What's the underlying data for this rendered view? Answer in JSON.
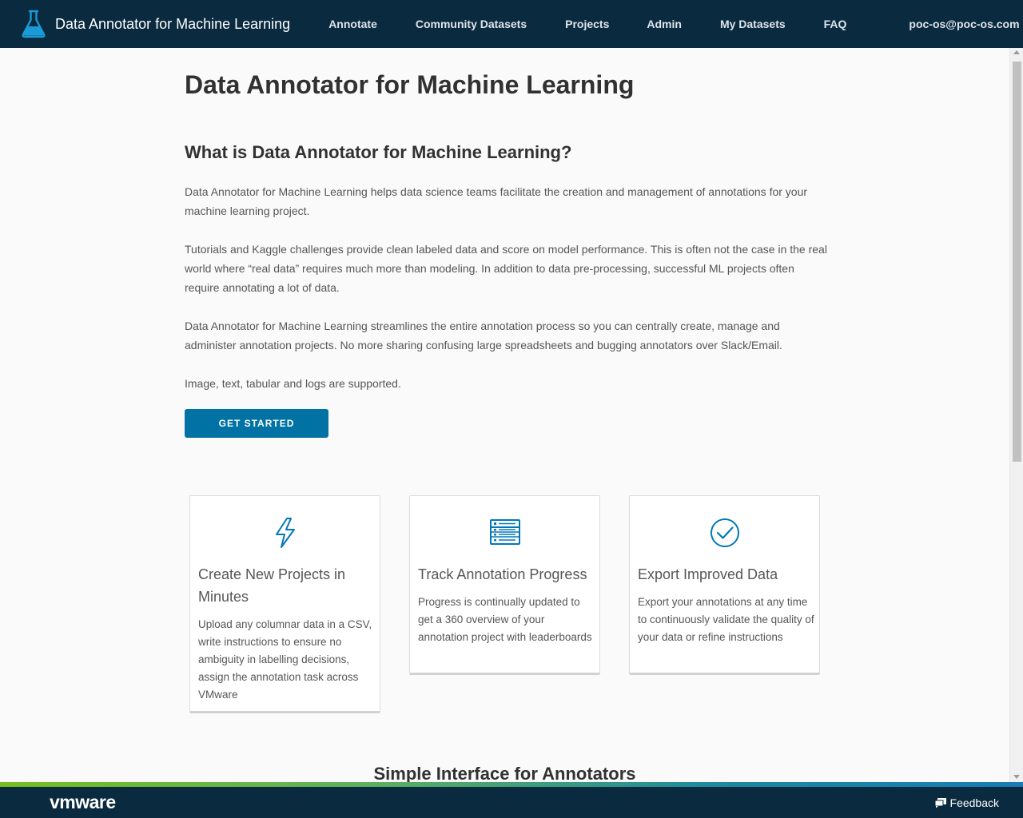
{
  "colors": {
    "header_bg": "#0a2a3f",
    "primary": "#0072a3",
    "icon_blue": "#0079b8",
    "page_bg": "#fafafa"
  },
  "header": {
    "app_title": "Data Annotator for Machine Learning",
    "logo_icon": "flask-icon",
    "nav": [
      "Annotate",
      "Community Datasets",
      "Projects",
      "Admin",
      "My Datasets",
      "FAQ"
    ],
    "user": "poc-os@poc-os.com"
  },
  "main": {
    "title": "Data Annotator for Machine Learning",
    "subtitle": "What is Data Annotator for Machine Learning?",
    "paragraphs": [
      "Data Annotator for Machine Learning helps data science teams facilitate the creation and management of annotations for your machine learning project.",
      "Tutorials and Kaggle challenges provide clean labeled data and score on model performance. This is often not the case in the real world where “real data” requires much more than modeling. In addition to data pre-processing, successful ML projects often require annotating a lot of data.",
      "Data Annotator for Machine Learning streamlines the entire annotation process so you can centrally create, manage and administer annotation projects. No more sharing confusing large spreadsheets and bugging annotators over Slack/Email.",
      "Image, text, tabular and logs are supported."
    ],
    "cta_label": "GET STARTED",
    "cards": [
      {
        "icon": "lightning-icon",
        "title": "Create New Projects in Minutes",
        "body": "Upload any columnar data in a CSV, write instructions to ensure no ambiguity in labelling decisions, assign the annotation task across VMware"
      },
      {
        "icon": "list-icon",
        "title": "Track Annotation Progress",
        "body": "Progress is continually updated to get a 360 overview of your annotation project with leaderboards"
      },
      {
        "icon": "check-circle-icon",
        "title": "Export Improved Data",
        "body": "Export your annotations at any time to continuously validate the quality of your data or refine instructions"
      }
    ],
    "section_title": "Simple Interface for Annotators"
  },
  "footer": {
    "logo_text": "vmware",
    "feedback_label": "Feedback",
    "feedback_icon": "chat-icon"
  }
}
